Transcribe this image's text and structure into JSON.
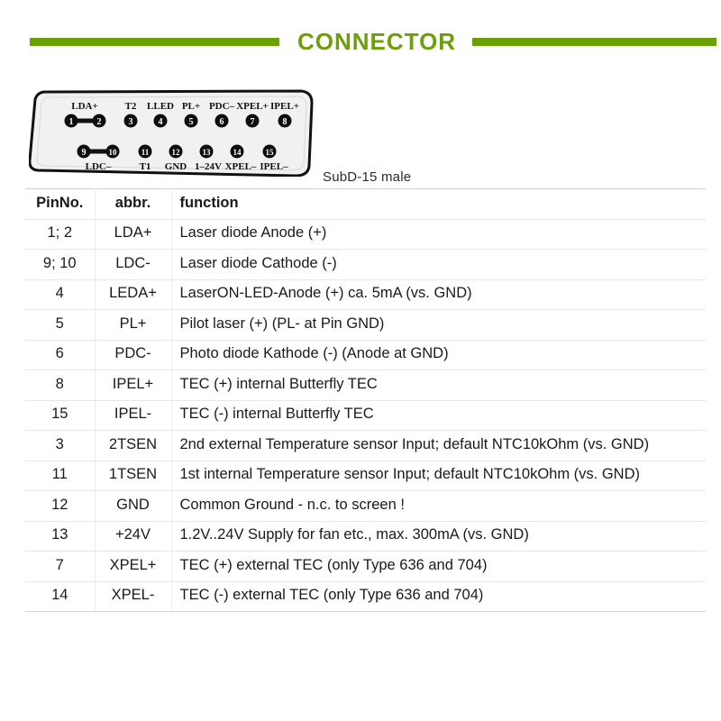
{
  "header": {
    "title": "CONNECTOR",
    "accent_color": "#6ba006"
  },
  "connector": {
    "caption": "SubD-15 male",
    "type": "SubD-15 male",
    "top_row": [
      {
        "pin": "1",
        "label": "LDA+",
        "label_span": true
      },
      {
        "pin": "2",
        "label": ""
      },
      {
        "pin": "3",
        "label": "T2"
      },
      {
        "pin": "4",
        "label": "LLED"
      },
      {
        "pin": "5",
        "label": "PL+"
      },
      {
        "pin": "6",
        "label": "PDC-"
      },
      {
        "pin": "7",
        "label": "XPEL+"
      },
      {
        "pin": "8",
        "label": "IPEL+"
      }
    ],
    "bottom_row": [
      {
        "pin": "9",
        "label": "LDC-",
        "label_span": true
      },
      {
        "pin": "10",
        "label": ""
      },
      {
        "pin": "11",
        "label": "T1"
      },
      {
        "pin": "12",
        "label": "GND"
      },
      {
        "pin": "13",
        "label": "1-24V"
      },
      {
        "pin": "14",
        "label": "XPEL-"
      },
      {
        "pin": "15",
        "label": "IPEL-"
      }
    ],
    "bridges": [
      {
        "from": "1",
        "to": "2"
      },
      {
        "from": "9",
        "to": "10"
      }
    ]
  },
  "table": {
    "headers": [
      "PinNo.",
      "abbr.",
      "function"
    ],
    "rows": [
      {
        "pin": "1; 2",
        "abbr": "LDA+",
        "function": "Laser diode Anode (+)"
      },
      {
        "pin": "9; 10",
        "abbr": "LDC-",
        "function": "Laser diode Cathode (-)"
      },
      {
        "pin": "4",
        "abbr": "LEDA+",
        "function": "LaserON-LED-Anode (+) ca. 5mA (vs. GND)"
      },
      {
        "pin": "5",
        "abbr": "PL+",
        "function": "Pilot laser (+) (PL- at Pin GND)"
      },
      {
        "pin": "6",
        "abbr": "PDC-",
        "function": "Photo diode Kathode (-) (Anode at GND)"
      },
      {
        "pin": "8",
        "abbr": "IPEL+",
        "function": "TEC (+) internal Butterfly TEC"
      },
      {
        "pin": "15",
        "abbr": "IPEL-",
        "function": "TEC (-) internal Butterfly TEC"
      },
      {
        "pin": "3",
        "abbr": "2TSEN",
        "function": "2nd external Temperature sensor Input;  default NTC10kOhm (vs. GND)"
      },
      {
        "pin": "11",
        "abbr": "1TSEN",
        "function": "1st  internal Temperature sensor Input;  default NTC10kOhm  (vs. GND)"
      },
      {
        "pin": "12",
        "abbr": "GND",
        "function": "Common Ground - n.c. to screen !"
      },
      {
        "pin": "13",
        "abbr": "+24V",
        "function": "1.2V..24V Supply for fan etc., max. 300mA (vs. GND)"
      },
      {
        "pin": "7",
        "abbr": "XPEL+",
        "function": "TEC (+) external TEC (only Type 636 and 704)"
      },
      {
        "pin": "14",
        "abbr": "XPEL-",
        "function": "TEC (-) external TEC (only Type 636 and 704)"
      }
    ]
  }
}
